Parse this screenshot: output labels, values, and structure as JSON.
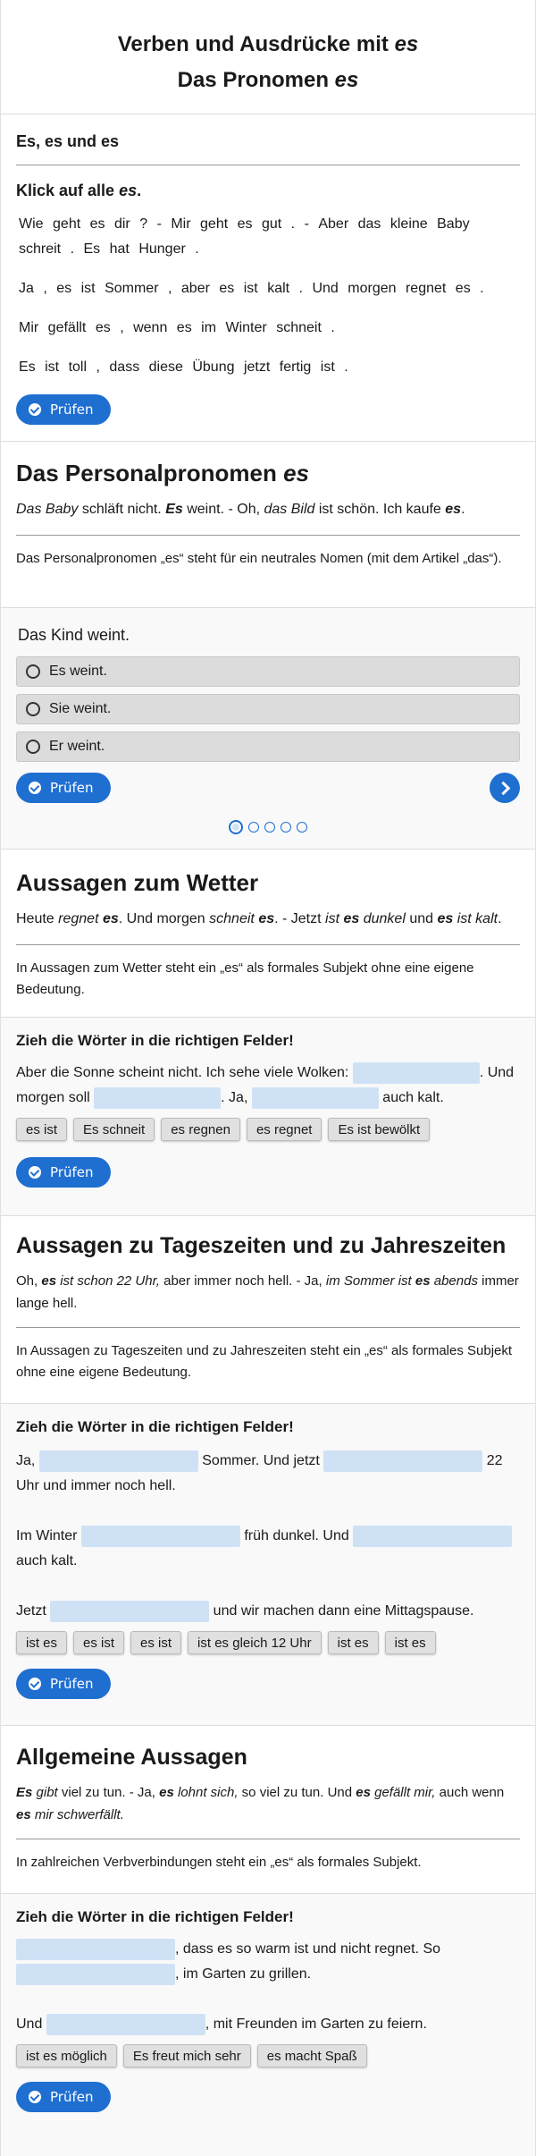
{
  "header": {
    "title": "Verben und Ausdrücke mit",
    "title_em": "es",
    "subtitle": "Das Pronomen",
    "subtitle_em": "es"
  },
  "s1": {
    "title": "Es, es und es",
    "instruction_pre": "Klick auf alle ",
    "instruction_em": "es",
    "instruction_post": ".",
    "line1": [
      "Wie",
      "geht",
      "es",
      "dir",
      "?",
      "-",
      "Mir",
      "geht",
      "es",
      "gut",
      ".",
      "-",
      "Aber",
      "das",
      "kleine",
      "Baby",
      "schreit",
      ".",
      "Es",
      "hat",
      "Hunger",
      "."
    ],
    "line2": [
      "Ja",
      ",",
      "es",
      "ist",
      "Sommer",
      ",",
      "aber",
      "es",
      "ist",
      "kalt",
      ".",
      "Und",
      "morgen",
      "regnet",
      "es",
      "."
    ],
    "line3": [
      "Mir",
      "gefällt",
      "es",
      ",",
      "wenn",
      "es",
      "im",
      "Winter",
      "schneit",
      "."
    ],
    "line4": [
      "Es",
      "ist",
      "toll",
      ",",
      "dass",
      "diese",
      "Übung",
      "jetzt",
      "fertig",
      "ist",
      "."
    ],
    "check": "Prüfen"
  },
  "s2": {
    "title": "Das Personalpronomen",
    "title_em": "es",
    "ex": {
      "a": "Das Baby",
      "b": " schläft nicht. ",
      "c": "Es",
      "d": " weint. - Oh, ",
      "e": "das Bild",
      "f": " ist schön. Ich kaufe ",
      "g": "es",
      "h": "."
    },
    "explain": "Das Personalpronomen „es“ steht für ein neutrales Nomen (mit dem Artikel „das“).",
    "question": "Das Kind weint.",
    "options": [
      "Es weint.",
      "Sie weint.",
      "Er weint."
    ],
    "check": "Prüfen"
  },
  "s3": {
    "title": "Aussagen zum Wetter",
    "ex": {
      "a": "Heute ",
      "b": "regnet",
      "c": "es",
      "d": ". Und morgen ",
      "e": "schneit",
      "f": "es",
      "g": ". - Jetzt ",
      "h": "ist",
      "i": "es",
      "j": "dunkel",
      "k": " und ",
      "l": "es",
      "m": "ist kalt",
      "n": "."
    },
    "explain": "In Aussagen zum Wetter steht ein „es“ als formales Subjekt ohne eine eigene Bedeutung.",
    "task": "Zieh die Wörter in die richtigen Felder!",
    "t1": "Aber die Sonne scheint nicht. Ich sehe viele Wolken: ",
    "t2": ". Und morgen soll ",
    "t3": ". Ja, ",
    "t4": " auch kalt.",
    "chips": [
      "es ist",
      "Es schneit",
      "es regnen",
      "es regnet",
      "Es ist bewölkt"
    ],
    "check": "Prüfen"
  },
  "s4": {
    "title": "Aussagen zu Tageszeiten und zu Jahreszeiten",
    "ex": {
      "a": "Oh, ",
      "b": "es",
      "c": " ist schon 22 Uhr,",
      "d": " aber immer noch hell. - Ja, ",
      "e": "im Sommer ist ",
      "f": "es",
      "g": " abends",
      "h": " immer lange hell."
    },
    "explain": "In Aussagen zu Tageszeiten und zu Jahreszeiten steht ein „es“ als formales Subjekt ohne eine eigene Bedeutung.",
    "task": "Zieh die Wörter in die richtigen Felder!",
    "p1a": "Ja, ",
    "p1b": " Sommer. Und jetzt ",
    "p1c": " 22 Uhr und immer noch hell.",
    "p2a": "Im Winter ",
    "p2b": " früh dunkel. Und ",
    "p2c": " auch kalt.",
    "p3a": "Jetzt ",
    "p3b": " und wir machen dann eine Mittagspause.",
    "chips": [
      "ist es",
      "es ist",
      "es ist",
      "ist es gleich 12 Uhr",
      "ist es",
      "ist es"
    ],
    "check": "Prüfen"
  },
  "s5": {
    "title": "Allgemeine Aussagen",
    "ex": {
      "a": "Es",
      "b": " gibt",
      "c": " viel zu tun. - Ja, ",
      "d": "es",
      "e": " lohnt sich,",
      "f": " so viel zu tun. Und ",
      "g": "es",
      "h": " gefällt mir,",
      "i": " auch wenn ",
      "j": "es",
      "k": " mir schwerfällt."
    },
    "explain": "In zahlreichen Verbverbindungen steht ein „es“ als formales Subjekt.",
    "task": "Zieh die Wörter in die richtigen Felder!",
    "p1b": ", dass es so warm ist und nicht regnet. So",
    "p1d": ", im Garten zu grillen.",
    "p2a": "Und ",
    "p2b": ", mit Freunden im Garten zu feiern.",
    "chips": [
      "ist es möglich",
      "Es freut mich sehr",
      "es macht Spaß"
    ],
    "check": "Prüfen"
  }
}
